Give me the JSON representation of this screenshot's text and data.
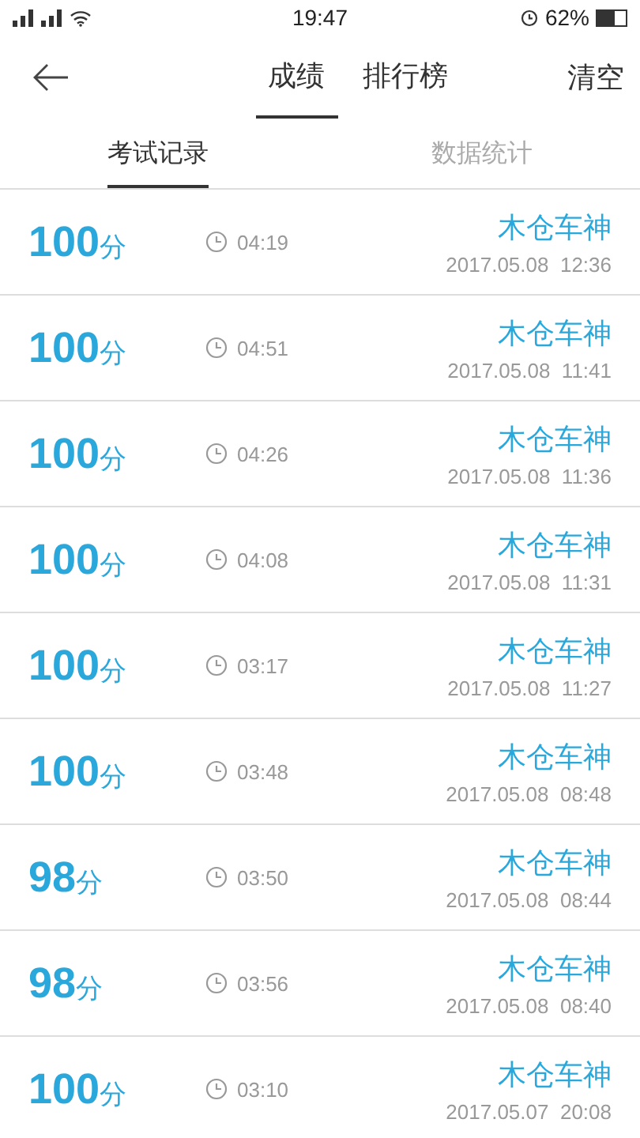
{
  "status_bar": {
    "time": "19:47",
    "battery": "62%"
  },
  "nav": {
    "tabs": [
      {
        "label": "成绩",
        "selected": true
      },
      {
        "label": "排行榜",
        "selected": false
      }
    ],
    "action": "清空"
  },
  "sub_tabs": [
    {
      "label": "考试记录",
      "selected": true
    },
    {
      "label": "数据统计",
      "selected": false
    }
  ],
  "records": [
    {
      "score": "100",
      "unit": "分",
      "duration": "04:19",
      "name": "木仓车神",
      "date": "2017.05.08  12:36"
    },
    {
      "score": "100",
      "unit": "分",
      "duration": "04:51",
      "name": "木仓车神",
      "date": "2017.05.08  11:41"
    },
    {
      "score": "100",
      "unit": "分",
      "duration": "04:26",
      "name": "木仓车神",
      "date": "2017.05.08  11:36"
    },
    {
      "score": "100",
      "unit": "分",
      "duration": "04:08",
      "name": "木仓车神",
      "date": "2017.05.08  11:31"
    },
    {
      "score": "100",
      "unit": "分",
      "duration": "03:17",
      "name": "木仓车神",
      "date": "2017.05.08  11:27"
    },
    {
      "score": "100",
      "unit": "分",
      "duration": "03:48",
      "name": "木仓车神",
      "date": "2017.05.08  08:48"
    },
    {
      "score": "98",
      "unit": "分",
      "duration": "03:50",
      "name": "木仓车神",
      "date": "2017.05.08  08:44"
    },
    {
      "score": "98",
      "unit": "分",
      "duration": "03:56",
      "name": "木仓车神",
      "date": "2017.05.08  08:40"
    },
    {
      "score": "100",
      "unit": "分",
      "duration": "03:10",
      "name": "木仓车神",
      "date": "2017.05.07  20:08"
    }
  ]
}
